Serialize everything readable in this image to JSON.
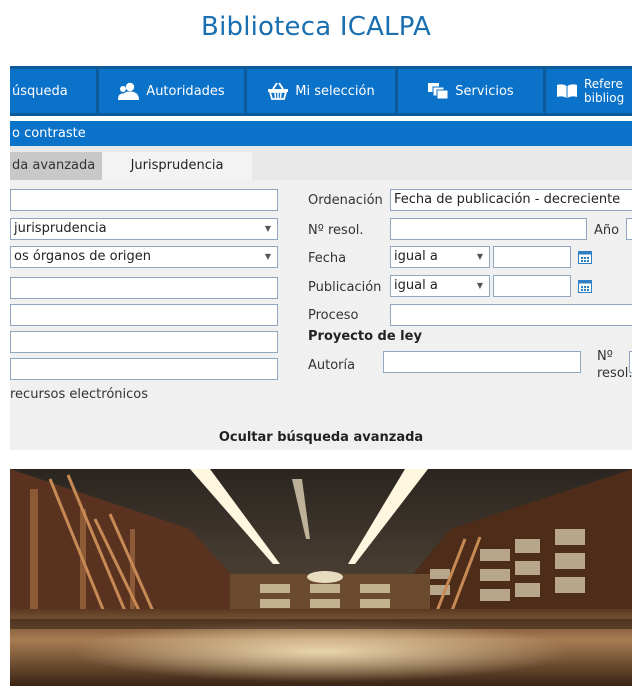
{
  "site": {
    "title": "Biblioteca ICALPA"
  },
  "nav": {
    "items": [
      {
        "label": "úsqueda"
      },
      {
        "label": "Autoridades"
      },
      {
        "label": "Mi selección"
      },
      {
        "label": "Servicios"
      },
      {
        "label_line1": "Refere",
        "label_line2": "bibliog"
      }
    ]
  },
  "contrast": {
    "label": "o contraste"
  },
  "tabs": {
    "advanced": "da avanzada",
    "jurisprudence": "Jurisprudencia"
  },
  "form": {
    "left": {
      "type_select": "jurisprudencia",
      "organ_select": "os órganos de origen",
      "electronic_resources": "recursos electrónicos"
    },
    "right": {
      "order_label": "Ordenación",
      "order_value": "Fecha de publicación - decreciente",
      "resolution_label": "Nº resol.",
      "year_label": "Año",
      "date_label": "Fecha",
      "date_operator": "igual a",
      "publication_label": "Publicación",
      "publication_operator": "igual a",
      "process_label": "Proceso",
      "bill_heading": "Proyecto de ley",
      "author_label": "Autoría",
      "bill_res_line1": "Nº",
      "bill_res_line2": "resol."
    },
    "toggle_label": "Ocultar búsqueda avanzada"
  },
  "colors": {
    "brand": "#0a72c8",
    "nav_dark": "#0c5a99",
    "title": "#1a6fb0"
  }
}
